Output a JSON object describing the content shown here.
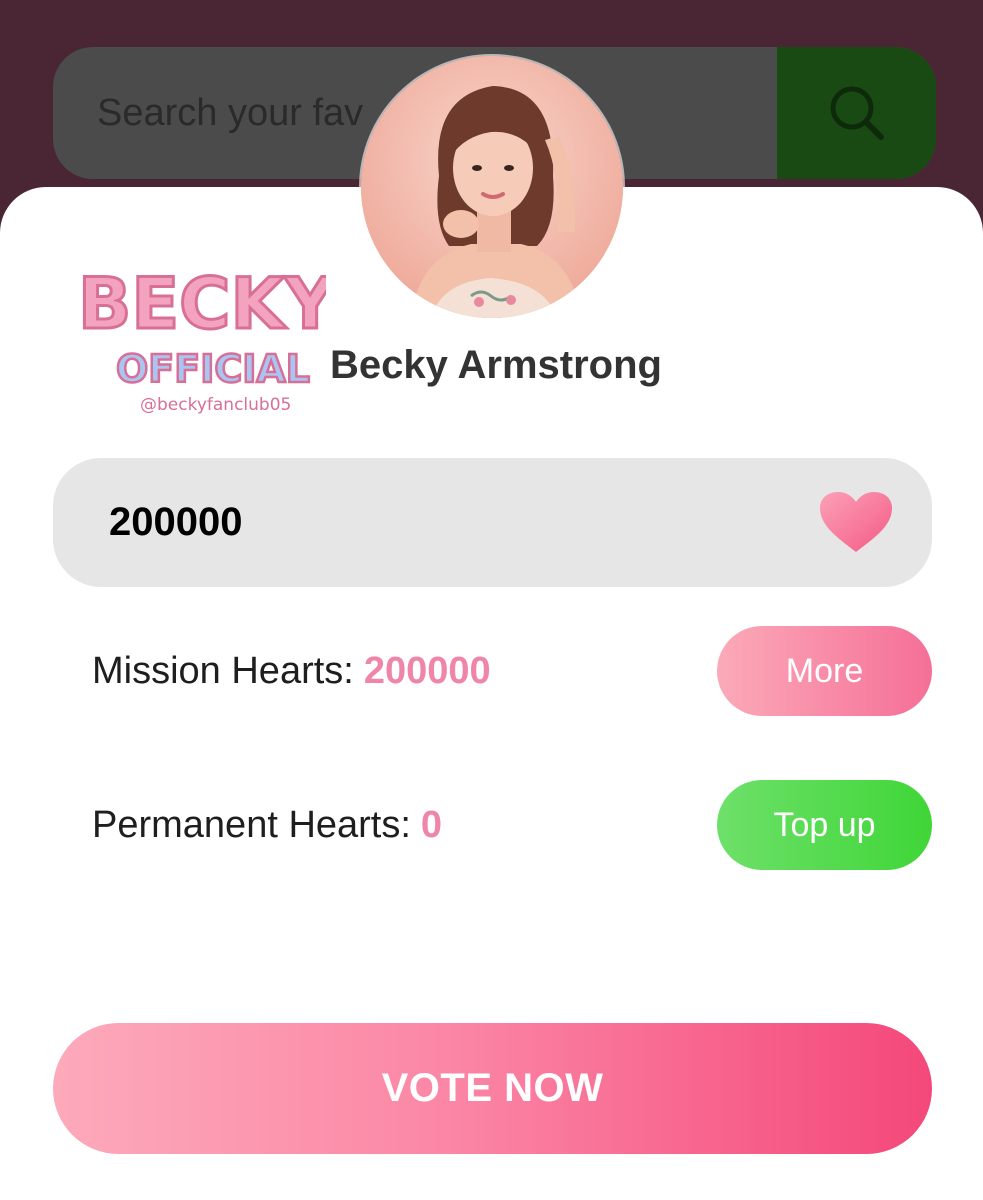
{
  "search": {
    "placeholder": "Search your fav",
    "icon": "search-icon"
  },
  "profile": {
    "avatar_icon": "profile-photo",
    "logo": {
      "line1": "BECKY",
      "line2": "OFFICIAL",
      "handle": "@beckyfanclub05"
    },
    "name": "Becky Armstrong"
  },
  "vote_input": {
    "value": "200000",
    "icon": "heart-icon"
  },
  "stats": {
    "mission": {
      "label": "Mission Hearts:",
      "value": "200000"
    },
    "permanent": {
      "label": "Permanent Hearts:",
      "value": "0"
    }
  },
  "buttons": {
    "more": "More",
    "top_up": "Top up",
    "vote": "VOTE NOW"
  },
  "colors": {
    "header_bg": "#4a2634",
    "accent_pink": "#f4487a",
    "accent_green": "#3fd637",
    "value_pink": "#ef86a9"
  }
}
